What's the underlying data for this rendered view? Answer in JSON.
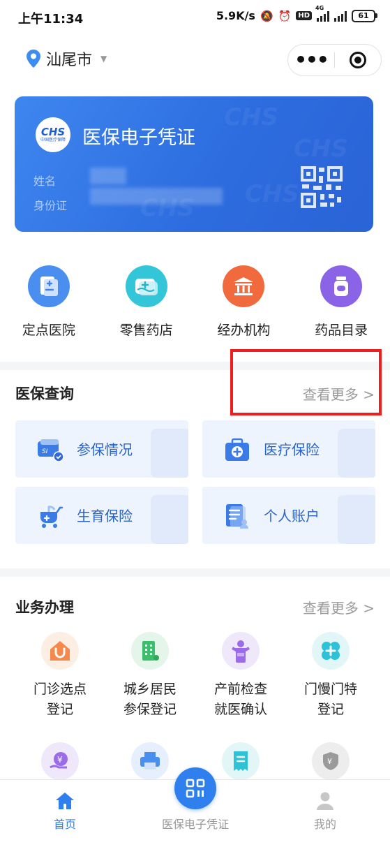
{
  "status_bar": {
    "time": "上午11:34",
    "speed": "5.9K/s",
    "hd": "HD",
    "network": "4G",
    "battery": "61"
  },
  "header": {
    "city": "汕尾市"
  },
  "card": {
    "logo_text": "CHS",
    "logo_sub": "中国医疗保障",
    "title": "医保电子凭证",
    "name_label": "姓名",
    "id_label": "身份证"
  },
  "quick_entries": [
    {
      "label": "定点医院",
      "color": "#4a8ff0"
    },
    {
      "label": "零售药店",
      "color": "#33c6d9"
    },
    {
      "label": "经办机构",
      "color": "#f16a3e"
    },
    {
      "label": "药品目录",
      "color": "#8a63e6"
    }
  ],
  "query_section": {
    "title": "医保查询",
    "more": "查看更多 >",
    "tiles": [
      {
        "label": "参保情况"
      },
      {
        "label": "医疗保险"
      },
      {
        "label": "生育保险"
      },
      {
        "label": "个人账户"
      }
    ]
  },
  "service_section": {
    "title": "业务办理",
    "more": "查看更多 >",
    "items": [
      {
        "line1": "门诊选点",
        "line2": "登记",
        "color": "#f5884a",
        "bg": "#fdeee4"
      },
      {
        "line1": "城乡居民",
        "line2": "参保登记",
        "color": "#3bbf6b",
        "bg": "#e4f6ea"
      },
      {
        "line1": "产前检查",
        "line2": "就医确认",
        "color": "#9b6ce8",
        "bg": "#efe8fb"
      },
      {
        "line1": "门慢门特",
        "line2": "登记",
        "color": "#2ec2d6",
        "bg": "#e2f6f8"
      }
    ],
    "second_row_icons": [
      "yuan-hand-icon",
      "printer-icon",
      "receipt-icon",
      "refund-icon"
    ]
  },
  "tabbar": {
    "home": "首页",
    "center": "医保电子凭证",
    "mine": "我的",
    "active_color": "#2f80ee",
    "inactive_color": "#999999"
  }
}
